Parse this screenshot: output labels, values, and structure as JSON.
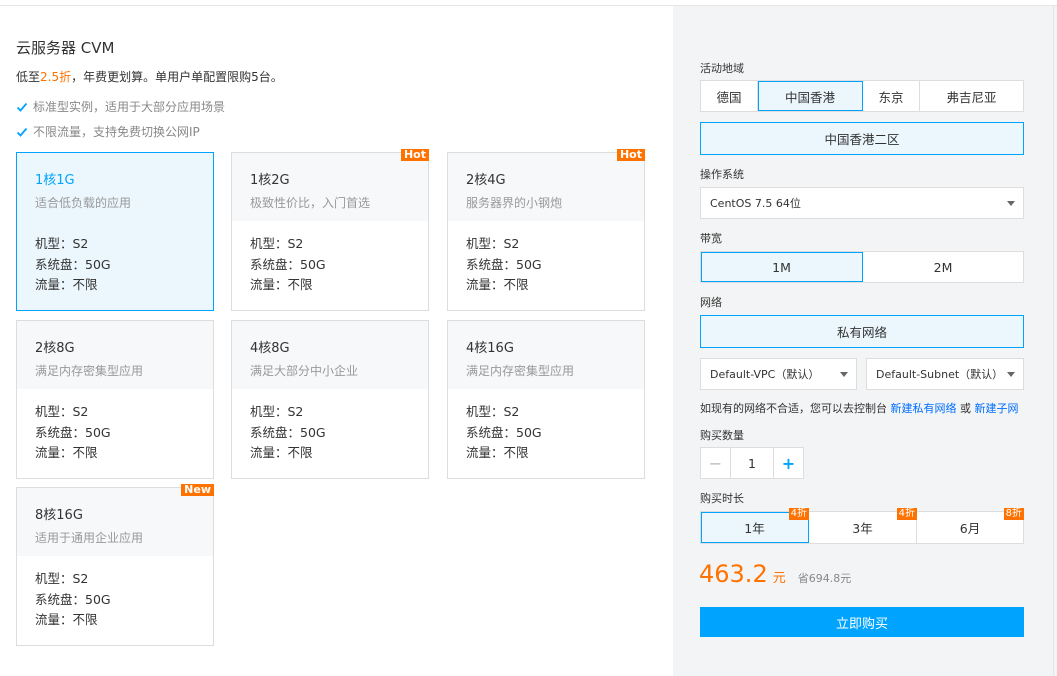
{
  "product": {
    "title": "云服务器 CVM",
    "desc_prefix": "低至",
    "desc_highlight": "2.5折",
    "desc_suffix": "，年费更划算。单用户单配置限购5台。",
    "features": [
      "标准型实例，适用于大部分应用场景",
      "不限流量，支持免费切换公网IP"
    ]
  },
  "cards": [
    {
      "name": "1核1G",
      "sub": "适合低负载的应用",
      "badge": "",
      "specs": [
        "机型：S2",
        "系统盘：50G",
        "流量：不限"
      ]
    },
    {
      "name": "1核2G",
      "sub": "极致性价比，入门首选",
      "badge": "Hot",
      "specs": [
        "机型：S2",
        "系统盘：50G",
        "流量：不限"
      ]
    },
    {
      "name": "2核4G",
      "sub": "服务器界的小钢炮",
      "badge": "Hot",
      "specs": [
        "机型：S2",
        "系统盘：50G",
        "流量：不限"
      ]
    },
    {
      "name": "2核8G",
      "sub": "满足内存密集型应用",
      "badge": "",
      "specs": [
        "机型：S2",
        "系统盘：50G",
        "流量：不限"
      ]
    },
    {
      "name": "4核8G",
      "sub": "满足大部分中小企业",
      "badge": "",
      "specs": [
        "机型：S2",
        "系统盘：50G",
        "流量：不限"
      ]
    },
    {
      "name": "4核16G",
      "sub": "满足内存密集型应用",
      "badge": "",
      "specs": [
        "机型：S2",
        "系统盘：50G",
        "流量：不限"
      ]
    },
    {
      "name": "8核16G",
      "sub": "适用于通用企业应用",
      "badge": "New",
      "specs": [
        "机型：S2",
        "系统盘：50G",
        "流量：不限"
      ]
    }
  ],
  "config": {
    "region_label": "活动地域",
    "regions": [
      "德国",
      "中国香港",
      "东京",
      "弗吉尼亚"
    ],
    "selected_region": "中国香港",
    "zone": "中国香港二区",
    "os_label": "操作系统",
    "os_value": "CentOS 7.5 64位",
    "bandwidth_label": "带宽",
    "bandwidth": [
      "1M",
      "2M"
    ],
    "network_label": "网络",
    "network": "私有网络",
    "vpc": "Default-VPC（默认）",
    "subnet": "Default-Subnet（默认）",
    "hint_prefix": "如现有的网络不合适，您可以去控制台",
    "hint_link1": "新建私有网络",
    "hint_or": "或",
    "hint_link2": "新建子网",
    "qty_label": "购买数量",
    "qty_minus": "−",
    "qty": "1",
    "qty_plus": "+",
    "duration_label": "购买时长",
    "durations": [
      {
        "label": "1年",
        "badge": "4折"
      },
      {
        "label": "3年",
        "badge": "4折"
      },
      {
        "label": "6月",
        "badge": "8折"
      }
    ],
    "price": "463.2",
    "price_unit": "元",
    "saved": "省694.8元",
    "buy": "立即购买"
  },
  "colors": {
    "accent": "#00a4ff",
    "highlight": "#ff7200",
    "link": "#006eff"
  }
}
